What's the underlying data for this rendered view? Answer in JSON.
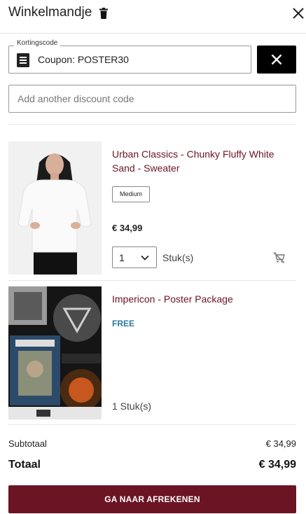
{
  "header": {
    "title": "Winkelmandje",
    "trash_icon": "trash-icon",
    "close_icon": "close-icon"
  },
  "coupon": {
    "legend": "Kortingscode",
    "applied_text": "Coupon: POSTER30",
    "icon": "receipt-icon",
    "remove_icon": "close-icon"
  },
  "discount_input": {
    "placeholder": "Add another discount code",
    "value": ""
  },
  "items": [
    {
      "title": "Urban Classics - Chunky Fluffy White Sand - Sweater",
      "variant": "Medium",
      "price": "€ 34,99",
      "quantity": "1",
      "quantity_unit": "Stuk(s)",
      "remove_icon": "remove-from-cart-icon"
    },
    {
      "title": "Impericon - Poster Package",
      "price_label": "FREE",
      "quantity_text": "1 Stuk(s)"
    }
  ],
  "summary": {
    "subtotal_label": "Subtotaal",
    "subtotal_value": "€ 34,99",
    "total_label": "Totaal",
    "total_value": "€ 34,99"
  },
  "checkout_label": "GA NAAR AFREKENEN",
  "colors": {
    "brand": "#6b1424",
    "free": "#2a7a9e",
    "dark": "#000000"
  }
}
